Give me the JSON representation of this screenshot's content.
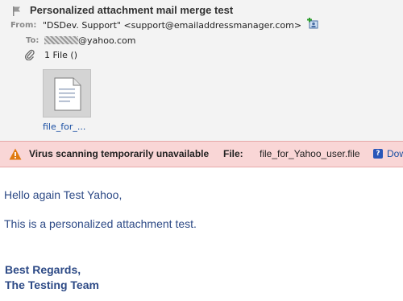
{
  "message": {
    "subject": "Personalized attachment mail merge test",
    "from_label": "From:",
    "from_value": "\"DSDev. Support\" <support@emailaddressmanager.com>",
    "to_label": "To:",
    "to_value": "@yahoo.com",
    "files_count": "1 File ()",
    "attachment": {
      "file_name": "file_for_..."
    }
  },
  "alert": {
    "strong_text": "Virus scanning temporarily unavailable",
    "file_label": "File:",
    "file_name": "file_for_Yahoo_user.file",
    "help_icon_text": "?",
    "link_text": "Dow"
  },
  "body": {
    "greeting": "Hello again Test Yahoo,",
    "line1": "This is a personalized attachment test.",
    "sign_line1": "Best Regards,",
    "sign_line2": "The Testing Team"
  },
  "colors": {
    "header_bg": "#f3f3f3",
    "alert_bg": "#f9d6d6",
    "warning_orange": "#e07a10",
    "body_text": "#2d4a86",
    "link": "#1a4fa3"
  },
  "icons": [
    "flag-icon",
    "add-contact-icon",
    "paperclip-icon",
    "document-icon",
    "warning-icon",
    "help-icon"
  ]
}
